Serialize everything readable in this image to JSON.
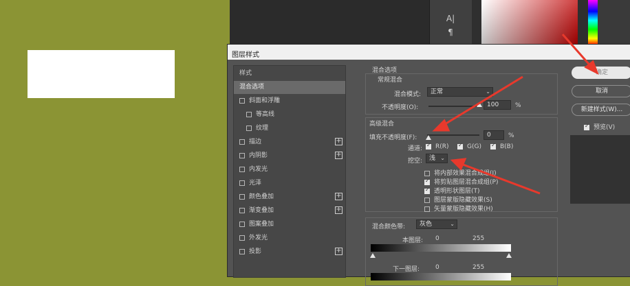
{
  "canvas": {
    "background_color": "#8b9434",
    "tool_icons": [
      "A|",
      "¶"
    ]
  },
  "dialog": {
    "title": "图层样式"
  },
  "styles_panel": {
    "items": [
      {
        "label": "样式",
        "type": "header"
      },
      {
        "label": "混合选项",
        "type": "selected"
      },
      {
        "label": "斜面和浮雕",
        "checked": false,
        "plus": false
      },
      {
        "label": "等高线",
        "checked": false,
        "indent": true
      },
      {
        "label": "纹理",
        "checked": false,
        "indent": true
      },
      {
        "label": "描边",
        "checked": false,
        "plus": true
      },
      {
        "label": "内阴影",
        "checked": false,
        "plus": true
      },
      {
        "label": "内发光",
        "checked": false,
        "plus": false
      },
      {
        "label": "光泽",
        "checked": false,
        "plus": false
      },
      {
        "label": "颜色叠加",
        "checked": false,
        "plus": true
      },
      {
        "label": "渐变叠加",
        "checked": false,
        "plus": true
      },
      {
        "label": "图案叠加",
        "checked": false,
        "plus": false
      },
      {
        "label": "外发光",
        "checked": false,
        "plus": false
      },
      {
        "label": "投影",
        "checked": false,
        "plus": true
      }
    ]
  },
  "blend_options": {
    "section_title": "混合选项",
    "general": {
      "title": "常规混合",
      "blend_mode_label": "混合模式:",
      "blend_mode_value": "正常",
      "opacity_label": "不透明度(O):",
      "opacity_value": "100",
      "opacity_unit": "%"
    },
    "advanced": {
      "title": "高级混合",
      "fill_opacity_label": "填充不透明度(F):",
      "fill_opacity_value": "0",
      "fill_opacity_unit": "%",
      "channels_label": "通道:",
      "channels": [
        {
          "label": "R(R)",
          "checked": true
        },
        {
          "label": "G(G)",
          "checked": true
        },
        {
          "label": "B(B)",
          "checked": true
        }
      ],
      "knockout_label": "挖空:",
      "knockout_value": "浅",
      "options": [
        {
          "label": "将内部效果混合成组(I)",
          "checked": false
        },
        {
          "label": "将剪贴图层混合成组(P)",
          "checked": true
        },
        {
          "label": "透明形状图层(T)",
          "checked": true
        },
        {
          "label": "图层蒙版隐藏效果(S)",
          "checked": false
        },
        {
          "label": "矢量蒙版隐藏效果(H)",
          "checked": false
        }
      ]
    },
    "blend_if": {
      "label": "混合颜色带:",
      "value": "灰色",
      "this_layer_label": "本图层:",
      "this_layer_min": "0",
      "this_layer_max": "255",
      "underlying_label": "下一图层:",
      "underlying_min": "0",
      "underlying_max": "255"
    }
  },
  "buttons": {
    "ok": "确定",
    "cancel": "取消",
    "new_style": "新建样式(W)...",
    "preview_label": "预览(V)",
    "preview_checked": true
  },
  "accent_colors": {
    "arrow_red": "#e8392c"
  }
}
